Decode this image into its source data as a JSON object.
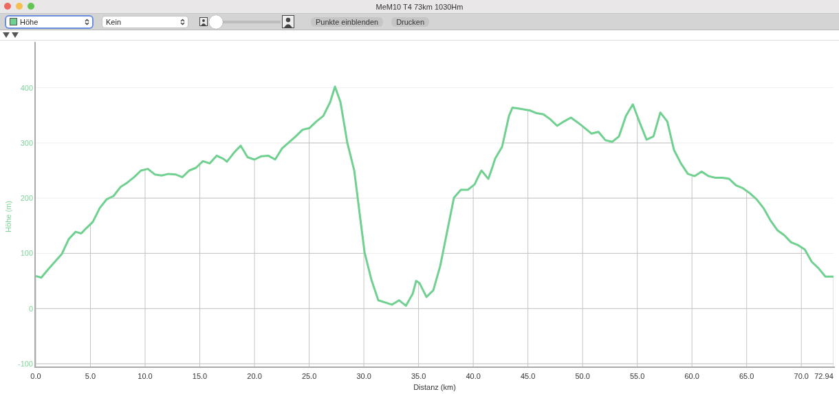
{
  "window": {
    "title": "MeM10 T4 73km 1030Hm"
  },
  "toolbar": {
    "primary_select": {
      "value": "Höhe",
      "focused": true
    },
    "secondary_select": {
      "value": "Kein",
      "focused": false
    },
    "zoom_slider": {
      "level": 0
    },
    "buttons": [
      "Punkte einblenden",
      "Drucken"
    ]
  },
  "chart": {
    "chart_data": {
      "type": "line",
      "xlabel": "Distanz (km)",
      "ylabel": "Höhe (m)",
      "xlim": [
        0,
        72.94
      ],
      "ylim": [
        -105,
        483
      ],
      "xticks": [
        {
          "value": 0,
          "label": "0.0"
        },
        {
          "value": 5,
          "label": "5.0"
        },
        {
          "value": 10,
          "label": "10.0"
        },
        {
          "value": 15,
          "label": "15.0"
        },
        {
          "value": 20,
          "label": "20.0"
        },
        {
          "value": 25,
          "label": "25.0"
        },
        {
          "value": 30,
          "label": "30.0"
        },
        {
          "value": 35,
          "label": "35.0"
        },
        {
          "value": 40,
          "label": "40.0"
        },
        {
          "value": 45,
          "label": "45.0"
        },
        {
          "value": 50,
          "label": "50.0"
        },
        {
          "value": 55,
          "label": "55.0"
        },
        {
          "value": 60,
          "label": "60.0"
        },
        {
          "value": 65,
          "label": "65.0"
        },
        {
          "value": 70,
          "label": "70.0"
        },
        {
          "value": 72.94,
          "label": "72.94"
        }
      ],
      "yticks": [
        -100,
        0,
        100,
        200,
        300,
        400
      ],
      "x": [
        0,
        0.5,
        1.13,
        1.76,
        2.39,
        3.02,
        3.65,
        4.15,
        4.59,
        5.22,
        5.85,
        6.48,
        7.11,
        7.74,
        8.36,
        8.99,
        9.62,
        10.25,
        10.88,
        11.51,
        12.14,
        12.77,
        13.4,
        14.03,
        14.65,
        15.28,
        15.91,
        16.54,
        17.17,
        17.48,
        18.11,
        18.74,
        19.37,
        20.0,
        20.63,
        21.26,
        21.89,
        22.52,
        23.14,
        23.77,
        24.4,
        25.03,
        25.66,
        26.29,
        26.92,
        27.36,
        27.86,
        28.49,
        29.12,
        29.75,
        30.06,
        30.69,
        31.32,
        31.95,
        32.58,
        33.21,
        33.84,
        34.47,
        34.78,
        35.09,
        35.72,
        36.35,
        36.98,
        37.61,
        38.24,
        38.87,
        39.5,
        40.13,
        40.44,
        40.75,
        41.38,
        41.7,
        42.01,
        42.64,
        43.27,
        43.58,
        44.21,
        45.16,
        45.79,
        46.42,
        47.04,
        47.67,
        48.3,
        48.93,
        49.56,
        50.19,
        50.82,
        51.45,
        52.08,
        52.7,
        53.33,
        53.96,
        54.59,
        55.22,
        55.85,
        56.48,
        57.11,
        57.74,
        58.36,
        58.99,
        59.62,
        60.25,
        60.88,
        61.51,
        62.14,
        62.77,
        63.4,
        64.03,
        64.65,
        65.28,
        65.91,
        66.54,
        67.17,
        67.8,
        68.43,
        69.06,
        69.69,
        70.31,
        70.94,
        71.57,
        72.2,
        72.94
      ],
      "grid": true,
      "series": [
        {
          "color": "#6fd08f",
          "values": [
            59,
            56,
            71,
            85,
            99,
            126,
            139,
            136,
            145,
            157,
            182,
            198,
            204,
            220,
            228,
            238,
            250,
            253,
            243,
            241,
            244,
            243,
            238,
            250,
            255,
            267,
            263,
            277,
            271,
            266,
            282,
            295,
            274,
            270,
            276,
            277,
            270,
            290,
            301,
            312,
            324,
            327,
            339,
            349,
            374,
            402,
            374,
            300,
            250,
            151,
            102,
            52,
            15,
            11,
            7,
            15,
            5,
            27,
            50,
            46,
            21,
            33,
            77,
            139,
            201,
            215,
            215,
            225,
            238,
            250,
            235,
            253,
            272,
            293,
            349,
            364,
            362,
            359,
            354,
            352,
            343,
            331,
            339,
            346,
            337,
            327,
            317,
            320,
            305,
            302,
            312,
            349,
            370,
            337,
            306,
            312,
            355,
            339,
            287,
            263,
            244,
            240,
            248,
            240,
            237,
            237,
            235,
            223,
            218,
            209,
            198,
            182,
            160,
            142,
            133,
            120,
            115,
            107,
            85,
            73,
            58,
            58
          ]
        }
      ]
    }
  }
}
